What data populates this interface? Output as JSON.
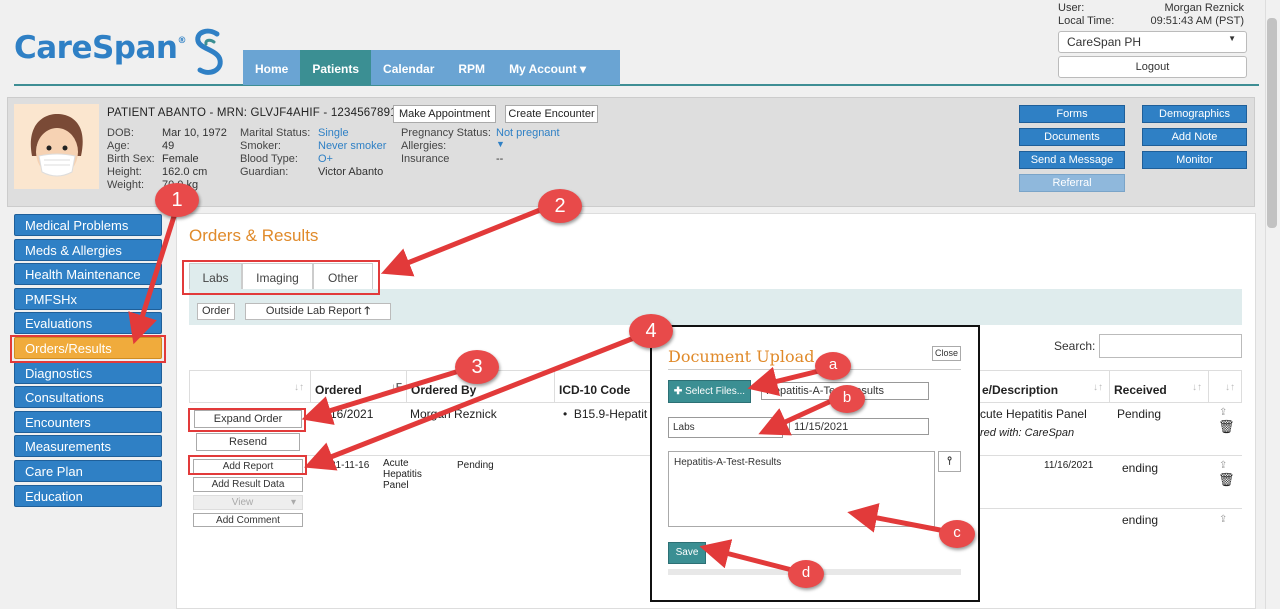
{
  "brand": {
    "name": "CareSpan",
    "mark": "®"
  },
  "nav": [
    "Home",
    "Patients",
    "Calendar",
    "RPM",
    "My Account ▾"
  ],
  "user": {
    "user_label": "User:",
    "user_name": "Morgan Reznick",
    "time_label": "Local Time:",
    "time_value": "09:51:43 AM (PST)",
    "org": "CareSpan PH",
    "logout": "Logout"
  },
  "patient": {
    "title": "PATIENT ABANTO - MRN: GLVJF4AHIF - 12345678910",
    "make_appointment": "Make Appointment",
    "create_encounter": "Create Encounter",
    "labels1": [
      "DOB:",
      "Age:",
      "Birth Sex:",
      "Height:",
      "Weight:"
    ],
    "values1": [
      "Mar 10, 1972",
      "49",
      "Female",
      "162.0 cm",
      "70.0 kg"
    ],
    "labels2": [
      "Marital Status:",
      "Smoker:",
      "Blood Type:",
      "Guardian:"
    ],
    "values2": [
      "Single",
      "Never smoker",
      "O+",
      "Victor Abanto"
    ],
    "labels3": [
      "Pregnancy Status:",
      "Allergies:",
      "Insurance"
    ],
    "values3": [
      "Not pregnant",
      "",
      "--"
    ]
  },
  "actions": {
    "col1": [
      "Forms",
      "Documents",
      "Send a Message",
      "Referral"
    ],
    "col2": [
      "Demographics",
      "Add Note",
      "Monitor"
    ]
  },
  "sidebar": [
    "Medical Problems",
    "Meds & Allergies",
    "Health Maintenance",
    "PMFSHx",
    "Evaluations",
    "Orders/Results",
    "Diagnostics",
    "Consultations",
    "Encounters",
    "Measurements",
    "Care Plan",
    "Education"
  ],
  "main": {
    "title": "Orders & Results",
    "tabs": [
      "Labs",
      "Imaging",
      "Other"
    ],
    "order_btn": "Order",
    "outside_btn": "Outside Lab Report",
    "search_label": "Search:"
  },
  "table": {
    "headers": [
      "Ordered",
      "Ordered By",
      "ICD-10 Code",
      "e/Description",
      "Received"
    ],
    "row1": {
      "ordered": "1/16/2021",
      "by": "Morgan Reznick",
      "icd": "B15.9-Hepatit",
      "desc1": "cute Hepatitis Panel",
      "desc2": "red with: CareSpan",
      "received": "Pending",
      "expand": "Expand Order",
      "resend": "Resend"
    },
    "row2": {
      "date": "21-11-16",
      "name": [
        "Acute",
        "Hepatitis",
        "Panel"
      ],
      "status": "Pending",
      "date2": "11/16/2021",
      "received": "ending",
      "add_report": "Add Report",
      "add_result": "Add Result Data",
      "view": "View",
      "add_comment": "Add Comment"
    },
    "row3": {
      "received": "ending"
    }
  },
  "dialog": {
    "title": "Document Upload",
    "close": "Close",
    "select_files": "Select Files...",
    "file_name": "Hepatitis-A-Test-Results",
    "category": "Labs",
    "date": "11/15/2021",
    "notes": "Hepatitis-A-Test-Results",
    "save": "Save"
  },
  "callouts": [
    "1",
    "2",
    "3",
    "4",
    "a",
    "b",
    "c",
    "d"
  ],
  "colors": {
    "primary": "#2f80c5",
    "teal": "#3b8f93",
    "orange": "#f0ab3c",
    "callout": "#e23a3a"
  }
}
